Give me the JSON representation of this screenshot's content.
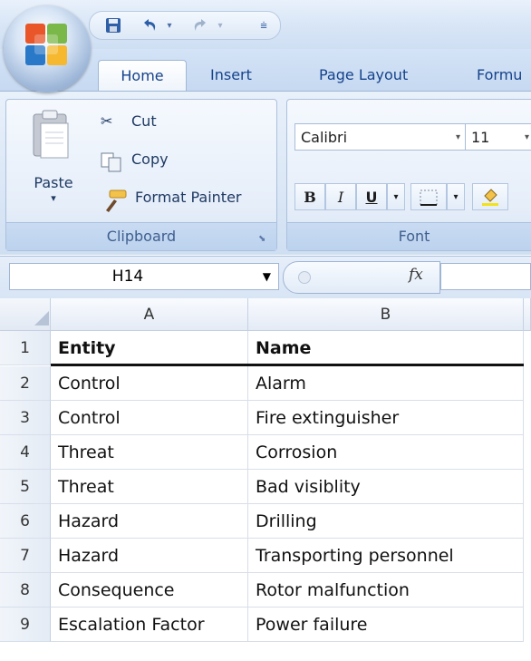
{
  "tabs": [
    "Home",
    "Insert",
    "Page Layout",
    "Formu"
  ],
  "clipboard": {
    "paste_label": "Paste",
    "cut_label": "Cut",
    "copy_label": "Copy",
    "format_painter_label": "Format Painter",
    "group_label": "Clipboard"
  },
  "font": {
    "font_name": "Calibri",
    "font_size": "11",
    "bold": "B",
    "italic": "I",
    "underline": "U",
    "group_label": "Font"
  },
  "formula_bar": {
    "name_box": "H14",
    "fx_label": "fx",
    "formula_value": ""
  },
  "columns": [
    "A",
    "B"
  ],
  "rows": [
    {
      "num": "1",
      "a": "Entity",
      "b": "Name"
    },
    {
      "num": "2",
      "a": "Control",
      "b": "Alarm"
    },
    {
      "num": "3",
      "a": "Control",
      "b": "Fire extinguisher"
    },
    {
      "num": "4",
      "a": "Threat",
      "b": "Corrosion"
    },
    {
      "num": "5",
      "a": "Threat",
      "b": "Bad visiblity"
    },
    {
      "num": "6",
      "a": "Hazard",
      "b": "Drilling"
    },
    {
      "num": "7",
      "a": "Hazard",
      "b": "Transporting personnel"
    },
    {
      "num": "8",
      "a": "Consequence",
      "b": "Rotor malfunction"
    },
    {
      "num": "9",
      "a": "Escalation Factor",
      "b": "Power failure"
    }
  ]
}
